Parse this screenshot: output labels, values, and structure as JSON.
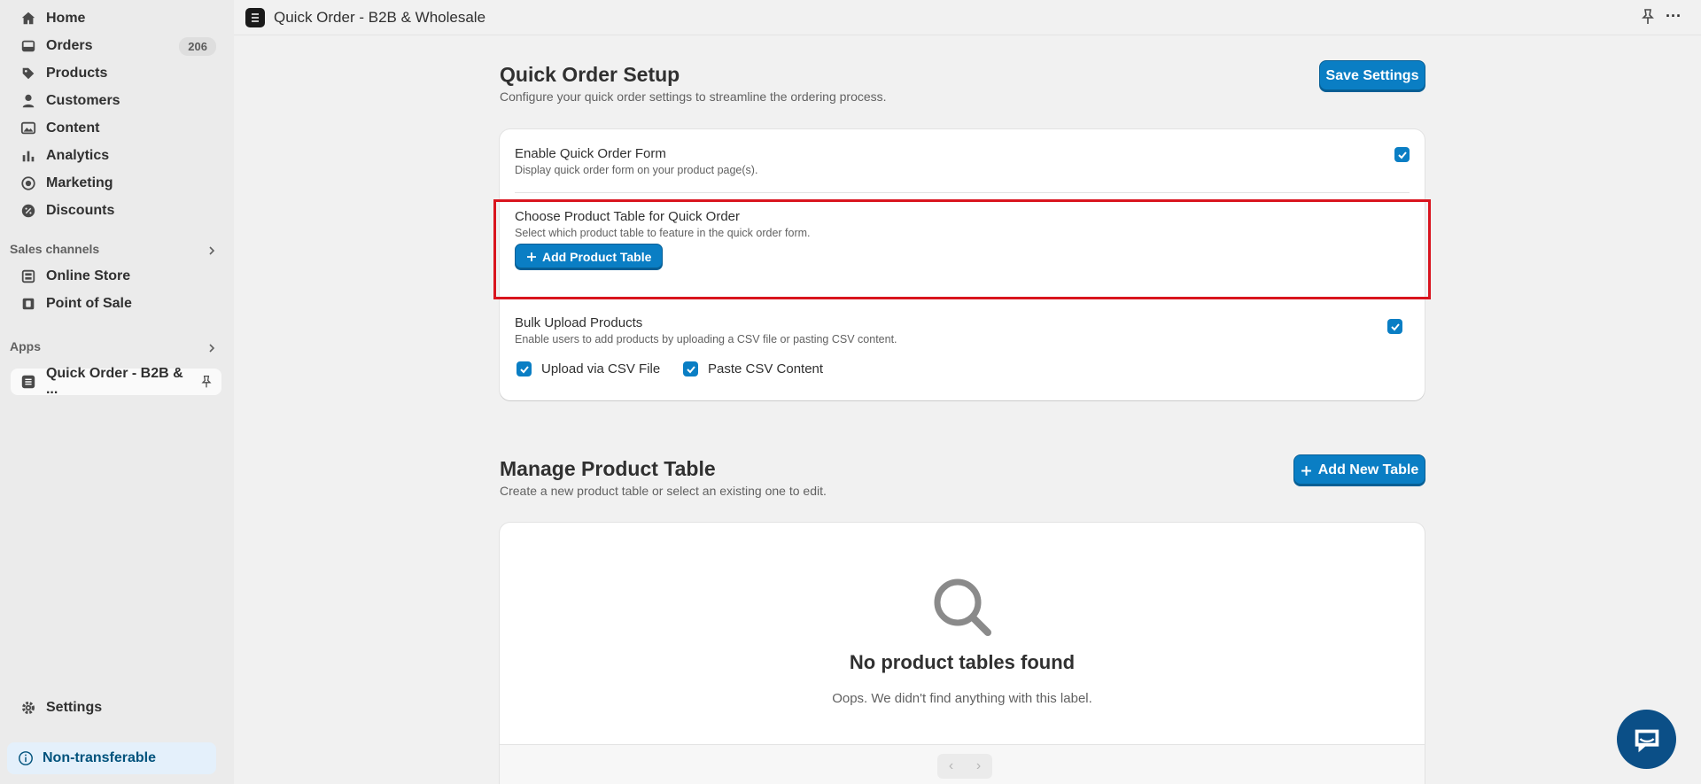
{
  "sidebar": {
    "items": [
      {
        "label": "Home",
        "icon": "home-icon"
      },
      {
        "label": "Orders",
        "icon": "inbox-icon",
        "badge": "206"
      },
      {
        "label": "Products",
        "icon": "tag-icon"
      },
      {
        "label": "Customers",
        "icon": "person-icon"
      },
      {
        "label": "Content",
        "icon": "image-icon"
      },
      {
        "label": "Analytics",
        "icon": "bar-chart-icon"
      },
      {
        "label": "Marketing",
        "icon": "target-icon"
      },
      {
        "label": "Discounts",
        "icon": "discount-icon"
      }
    ],
    "sales_channels_label": "Sales channels",
    "channels": [
      {
        "label": "Online Store",
        "icon": "store-icon"
      },
      {
        "label": "Point of Sale",
        "icon": "pos-icon"
      }
    ],
    "apps_label": "Apps",
    "app_item": "Quick Order - B2B & ...",
    "settings_label": "Settings",
    "non_transferable": "Non-transferable"
  },
  "topbar": {
    "title": "Quick Order - B2B & Wholesale",
    "more": "···"
  },
  "setup": {
    "title": "Quick Order Setup",
    "subtitle": "Configure your quick order settings to streamline the ordering process.",
    "save_label": "Save Settings",
    "enable_title": "Enable Quick Order Form",
    "enable_sub": "Display quick order form on your product page(s).",
    "enable_checked": true,
    "choose_title": "Choose Product Table for Quick Order",
    "choose_sub": "Select which product table to feature in the quick order form.",
    "add_product_table_label": "Add Product Table",
    "bulk_title": "Bulk Upload Products",
    "bulk_sub": "Enable users to add products by uploading a CSV file or pasting CSV content.",
    "bulk_checked": true,
    "upload_csv_label": "Upload via CSV File",
    "paste_csv_label": "Paste CSV Content"
  },
  "manage": {
    "title": "Manage Product Table",
    "subtitle": "Create a new product table or select an existing one to edit.",
    "add_new_label": "Add New Table",
    "empty_title": "No product tables found",
    "empty_sub": "Oops. We didn't find anything with this label.",
    "prev": "‹",
    "next": "›"
  },
  "colors": {
    "accent": "#0a7ec4",
    "highlight": "#d9141e"
  }
}
